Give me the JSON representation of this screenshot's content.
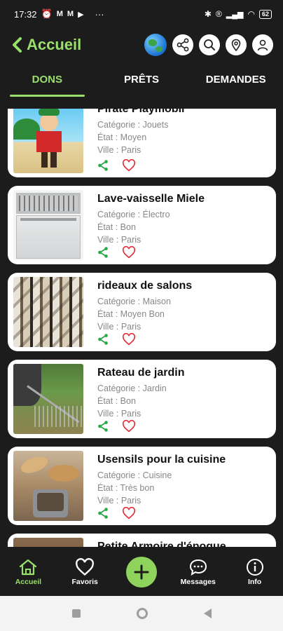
{
  "status": {
    "time": "17:32",
    "battery": "62"
  },
  "header": {
    "back_label": "Accueil"
  },
  "tabs": [
    {
      "label": "DONS",
      "active": true
    },
    {
      "label": "PRÊTS",
      "active": false
    },
    {
      "label": "DEMANDES",
      "active": false
    }
  ],
  "items": [
    {
      "title": "Pirate Playmobil",
      "category": "Catégorie : Jouets",
      "state": "État : Moyen",
      "city": "Ville : Paris"
    },
    {
      "title": "Lave-vaisselle Miele",
      "category": "Catégorie : Électro",
      "state": "État : Bon",
      "city": "Ville : Paris"
    },
    {
      "title": "rideaux de salons",
      "category": "Catégorie : Maison",
      "state": "État : Moyen Bon",
      "city": "Ville : Paris"
    },
    {
      "title": "Rateau de jardin",
      "category": "Catégorie : Jardin",
      "state": "État : Bon",
      "city": "Ville : Paris"
    },
    {
      "title": "Usensils pour la cuisine",
      "category": "Catégorie : Cuisine",
      "state": "État : Très bon",
      "city": "Ville : Paris"
    },
    {
      "title": "Petite Armoire d'époque"
    }
  ],
  "bottom_nav": [
    {
      "label": "Accueil",
      "icon": "home-icon",
      "active": true
    },
    {
      "label": "Favoris",
      "icon": "heart-icon",
      "active": false
    },
    {
      "label": "",
      "icon": "plus-icon",
      "active": false
    },
    {
      "label": "Messages",
      "icon": "chat-icon",
      "active": false
    },
    {
      "label": "Info",
      "icon": "info-icon",
      "active": false
    }
  ],
  "colors": {
    "accent": "#9adf6c",
    "background": "#1c1c1c",
    "share": "#2aa84a",
    "heart": "#e0303a"
  }
}
